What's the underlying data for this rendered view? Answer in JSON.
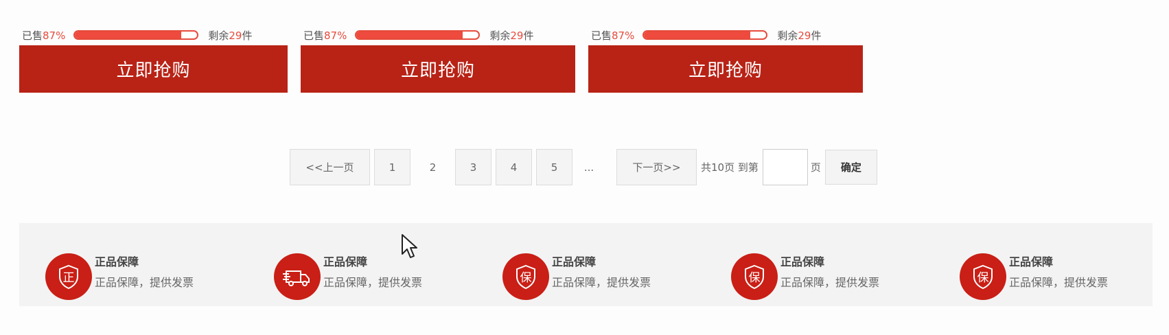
{
  "products": [
    {
      "sold_label": "已售",
      "sold_percent": "87%",
      "progress": 0.87,
      "remain_prefix": "剩余",
      "remain_count": "29",
      "remain_unit": "件",
      "button": "立即抢购"
    },
    {
      "sold_label": "已售",
      "sold_percent": "87%",
      "progress": 0.87,
      "remain_prefix": "剩余",
      "remain_count": "29",
      "remain_unit": "件",
      "button": "立即抢购"
    },
    {
      "sold_label": "已售",
      "sold_percent": "87%",
      "progress": 0.87,
      "remain_prefix": "剩余",
      "remain_count": "29",
      "remain_unit": "件",
      "button": "立即抢购"
    }
  ],
  "pagination": {
    "prev": "<<上一页",
    "pages": [
      "1",
      "2",
      "3",
      "4",
      "5"
    ],
    "current": "2",
    "ellipsis": "...",
    "next": "下一页>>",
    "total": "共10页 到第",
    "jump_value": "",
    "page_unit": "页",
    "confirm": "确定"
  },
  "guarantees": [
    {
      "icon": "genuine-icon",
      "icon_char": "正",
      "title": "正品保障",
      "desc": "正品保障，提供发票"
    },
    {
      "icon": "delivery-truck-icon",
      "icon_char": "",
      "title": "正品保障",
      "desc": "正品保障，提供发票"
    },
    {
      "icon": "shield-guarantee-icon",
      "icon_char": "保",
      "title": "正品保障",
      "desc": "正品保障，提供发票"
    },
    {
      "icon": "shield-guarantee-icon",
      "icon_char": "保",
      "title": "正品保障",
      "desc": "正品保障，提供发票"
    },
    {
      "icon": "shield-guarantee-icon",
      "icon_char": "保",
      "title": "正品保障",
      "desc": "正品保障，提供发票"
    }
  ],
  "colors": {
    "button_red": "#b82316",
    "accent_red": "#e64b3c",
    "icon_red": "#c91f16",
    "strip_bg": "#f3f3f3"
  }
}
